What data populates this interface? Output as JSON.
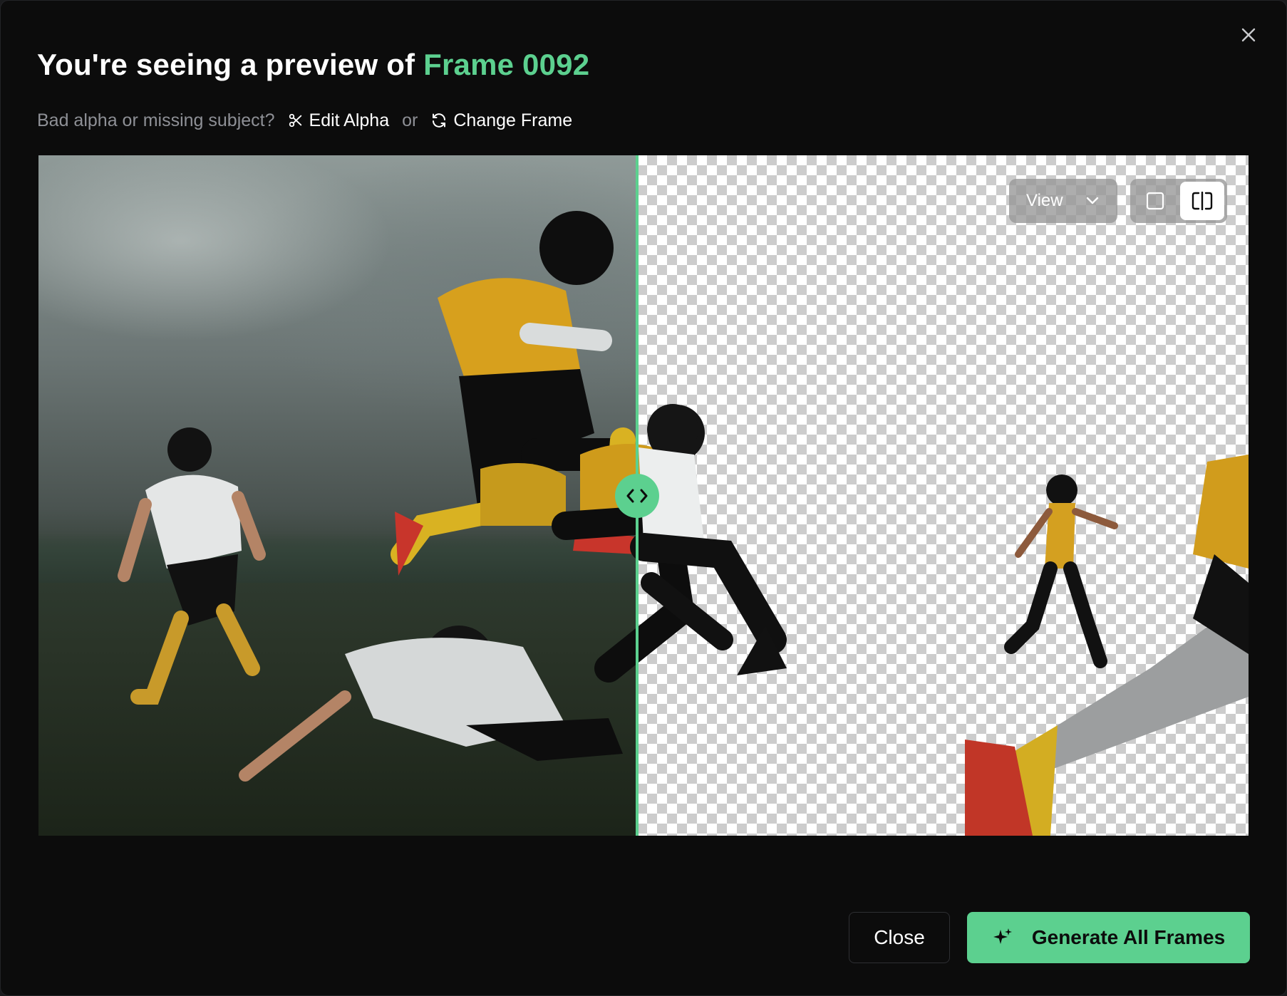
{
  "dialog": {
    "title_prefix": "You're seeing a preview of ",
    "title_frame": "Frame 0092",
    "prompt": "Bad alpha or missing subject?",
    "edit_alpha_label": "Edit Alpha",
    "or_label": "or",
    "change_frame_label": "Change Frame",
    "close_icon": "close-icon"
  },
  "preview": {
    "view_label": "View",
    "view_icon": "chevron-down-icon",
    "modes": [
      {
        "name": "single-view",
        "icon": "square-icon",
        "active": false
      },
      {
        "name": "split-view",
        "icon": "split-compare-icon",
        "active": true
      }
    ],
    "split_position": 0.495,
    "handle_icon": "left-right-arrows-icon"
  },
  "footer": {
    "close_label": "Close",
    "generate_label": "Generate All Frames",
    "generate_icon": "sparkle-icon"
  },
  "colors": {
    "accent": "#5cd08f",
    "background": "#0c0c0c",
    "text": "#ffffff",
    "muted": "#8e9096"
  }
}
